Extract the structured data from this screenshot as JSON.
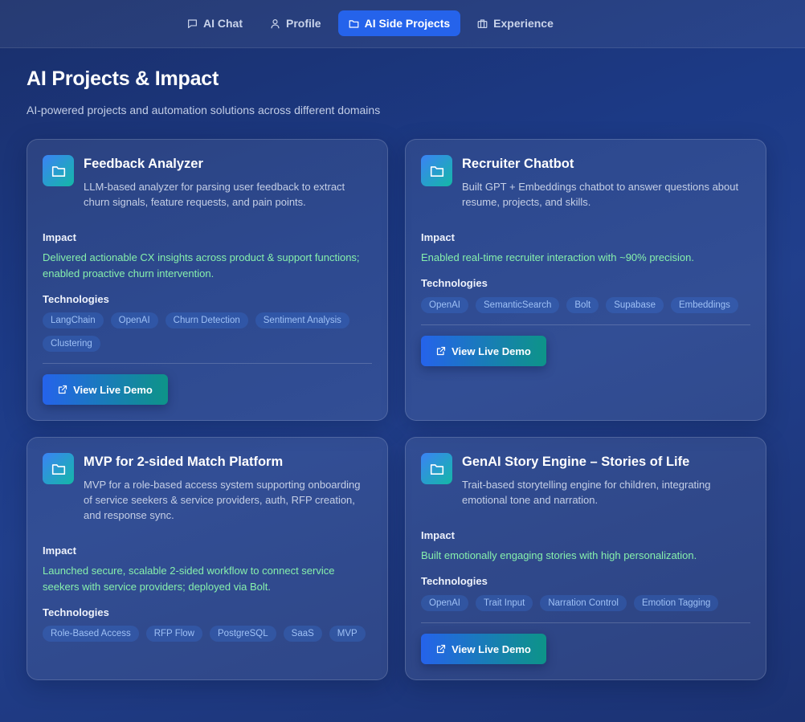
{
  "nav": {
    "tabs": [
      {
        "label": "AI Chat",
        "icon": "chat-icon"
      },
      {
        "label": "Profile",
        "icon": "user-icon"
      },
      {
        "label": "AI Side Projects",
        "icon": "folder-icon",
        "active": true
      },
      {
        "label": "Experience",
        "icon": "briefcase-icon"
      }
    ]
  },
  "page": {
    "title": "AI Projects & Impact",
    "subtitle": "AI-powered projects and automation solutions across different domains"
  },
  "labels": {
    "impact": "Impact",
    "technologies": "Technologies",
    "demo_button": "View Live Demo"
  },
  "colors": {
    "accent": "#2563eb",
    "teal": "#0d9488",
    "impact_green": "#86efac"
  },
  "projects": [
    {
      "title": "Feedback Analyzer",
      "description": "LLM-based analyzer for parsing user feedback to extract churn signals, feature requests, and pain points.",
      "impact": "Delivered actionable CX insights across product & support functions; enabled proactive churn intervention.",
      "technologies": [
        "LangChain",
        "OpenAI",
        "Churn Detection",
        "Sentiment Analysis",
        "Clustering"
      ]
    },
    {
      "title": "Recruiter Chatbot",
      "description": "Built GPT + Embeddings chatbot to answer questions about resume, projects, and skills.",
      "impact": "Enabled real-time recruiter interaction with ~90% precision.",
      "technologies": [
        "OpenAI",
        "SemanticSearch",
        "Bolt",
        "Supabase",
        "Embeddings"
      ]
    },
    {
      "title": "MVP for 2-sided Match Platform",
      "description": "MVP for a role-based access system supporting onboarding of service seekers & service providers, auth, RFP creation, and response sync.",
      "impact": "Launched secure, scalable 2-sided workflow to connect service seekers with service providers; deployed via Bolt.",
      "technologies": [
        "Role-Based Access",
        "RFP Flow",
        "PostgreSQL",
        "SaaS",
        "MVP"
      ]
    },
    {
      "title": "GenAI Story Engine – Stories of Life",
      "description": "Trait-based storytelling engine for children, integrating emotional tone and narration.",
      "impact": "Built emotionally engaging stories with high personalization.",
      "technologies": [
        "OpenAI",
        "Trait Input",
        "Narration Control",
        "Emotion Tagging"
      ]
    }
  ]
}
